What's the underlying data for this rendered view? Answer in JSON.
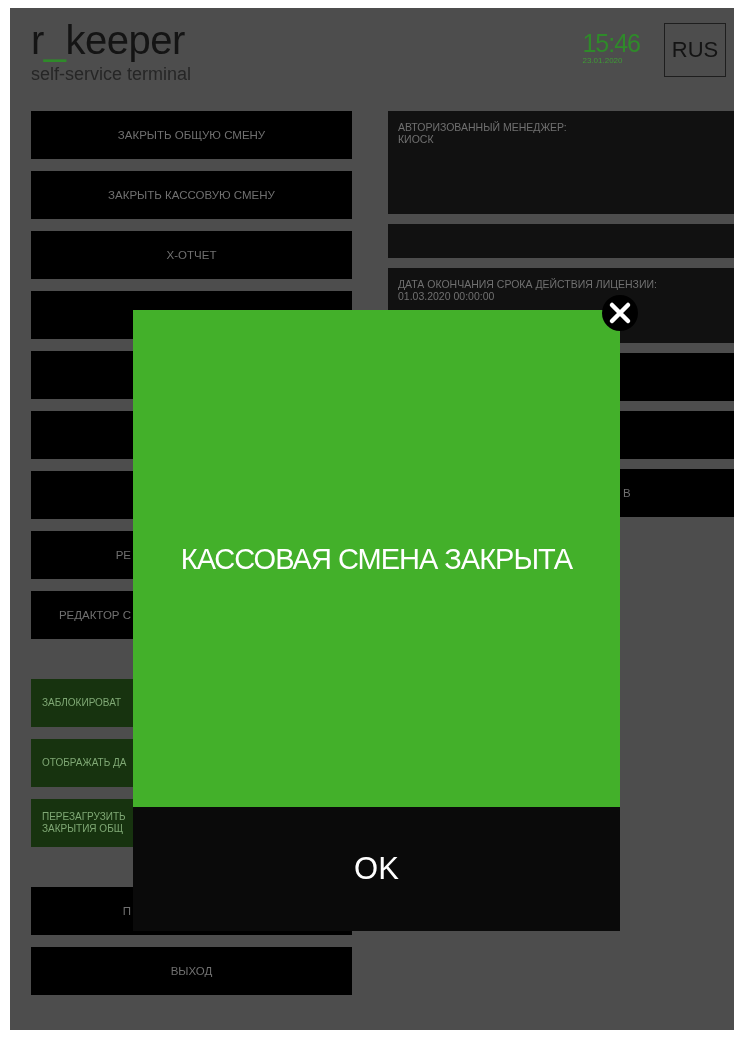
{
  "header": {
    "logo_start": "r",
    "logo_accent": "_",
    "logo_end": "keeper",
    "subtitle": "self-service terminal",
    "time": "15:46",
    "date": "23.01.2020",
    "language": "RUS"
  },
  "left_groups": [
    {
      "buttons": [
        {
          "kind": "plain",
          "label": "ЗАКРЫТЬ ОБЩУЮ СМЕНУ"
        },
        {
          "kind": "plain",
          "label": "ЗАКРЫТЬ КАССОВУЮ СМЕНУ"
        },
        {
          "kind": "plain",
          "label": "Х-ОТЧЕТ"
        },
        {
          "kind": "plain"
        },
        {
          "kind": "plain"
        },
        {
          "kind": "plain"
        },
        {
          "kind": "plain"
        },
        {
          "kind": "cut",
          "label": "РЕ"
        },
        {
          "kind": "cut",
          "label": "РЕДАКТОР С"
        }
      ]
    },
    {
      "buttons": [
        {
          "kind": "green",
          "label": "ЗАБЛОКИРОВАТ"
        },
        {
          "kind": "green",
          "label": "ОТОБРАЖАТЬ ДА"
        },
        {
          "kind": "green",
          "label": "ПЕРЕЗАГРУЗИТЬ\nЗАКРЫТИЯ ОБЩ"
        }
      ]
    },
    {
      "buttons": [
        {
          "kind": "cut",
          "label": "П"
        },
        {
          "kind": "plain",
          "label": "ВЫХОД"
        }
      ]
    }
  ],
  "info_panels": [
    {
      "kind": "tall",
      "lines": [
        "АВТОРИЗОВАННЫЙ МЕНЕДЖЕР:",
        "КИОСК"
      ]
    },
    {
      "kind": "short"
    },
    {
      "kind": "medium",
      "lines": [
        "ДАТА ОКОНЧАНИЯ СРОКА ДЕЙСТВИЯ ЛИЦЕНЗИИ:",
        "01.03.2020 00:00:00"
      ]
    }
  ],
  "right_buttons": [
    {
      "kind": "plain"
    },
    {
      "kind": "plain"
    },
    {
      "kind": "cut",
      "label": "В"
    }
  ],
  "dialog": {
    "message": "КАССОВАЯ СМЕНА ЗАКРЫТА",
    "ok": "OK"
  }
}
